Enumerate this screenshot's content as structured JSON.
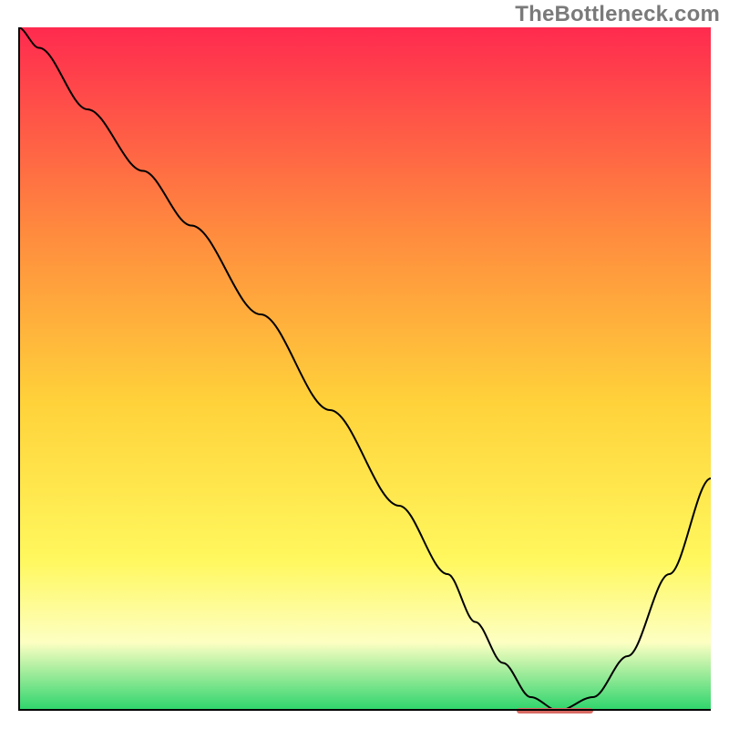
{
  "watermark": "TheBottleneck.com",
  "colors": {
    "grad_top": "#ff2a4f",
    "grad_mid1": "#ff8b3e",
    "grad_mid2": "#ffd23a",
    "grad_mid3": "#fff85e",
    "grad_mid4": "#fdffc2",
    "grad_bottom": "#2bd46b",
    "curve": "#000000",
    "marker": "#d86a63",
    "axis": "#000000"
  },
  "chart_data": {
    "type": "line",
    "title": "",
    "xlabel": "",
    "ylabel": "",
    "xlim": [
      0,
      100
    ],
    "ylim": [
      0,
      100
    ],
    "x": [
      0,
      3,
      10,
      18,
      25,
      35,
      45,
      55,
      62,
      66,
      70,
      74,
      78,
      83,
      88,
      94,
      100
    ],
    "values": [
      100,
      97,
      88,
      79,
      71,
      58,
      44,
      30,
      20,
      13,
      7,
      2,
      0,
      2,
      8,
      20,
      34
    ],
    "trough": {
      "x_start": 72,
      "x_end": 83,
      "y": 0
    },
    "gradient_stops": [
      {
        "offset": 0.0,
        "key": "grad_top"
      },
      {
        "offset": 0.3,
        "key": "grad_mid1"
      },
      {
        "offset": 0.55,
        "key": "grad_mid2"
      },
      {
        "offset": 0.78,
        "key": "grad_mid3"
      },
      {
        "offset": 0.9,
        "key": "grad_mid4"
      },
      {
        "offset": 1.0,
        "key": "grad_bottom"
      }
    ]
  }
}
